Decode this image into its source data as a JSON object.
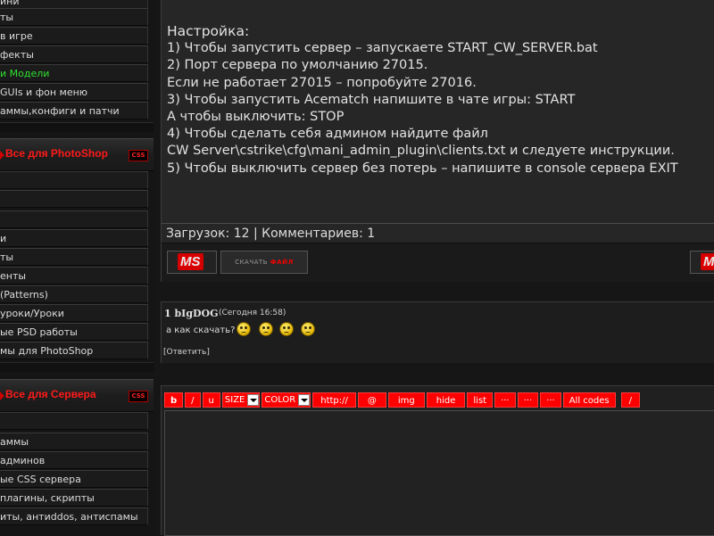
{
  "sidebar": {
    "top_items": [
      {
        "label": "ини"
      },
      {
        "label": "ты"
      },
      {
        "label": "в игре"
      },
      {
        "label": "фекты"
      },
      {
        "label": "и Модели",
        "highlight": true
      },
      {
        "label": "GUIs и фон меню"
      },
      {
        "label": "аммы,конфиги и патчи"
      }
    ],
    "photoshop_block": {
      "title": "Все для PhotoShop",
      "badge": "CSS",
      "items": [
        {
          "label": ""
        },
        {
          "label": ""
        },
        {
          "label": ""
        },
        {
          "label": "и"
        },
        {
          "label": "ты"
        },
        {
          "label": "енты"
        },
        {
          "label": "(Patterns)"
        },
        {
          "label": "уроки/Уроки"
        },
        {
          "label": "ые PSD работы"
        },
        {
          "label": "мы для PhotoShop"
        }
      ]
    },
    "server_block": {
      "title": "Все для Сервера",
      "badge": "CSS",
      "items": [
        {
          "label": ""
        },
        {
          "label": "аммы"
        },
        {
          "label": "админов"
        },
        {
          "label": "ые CSS сервера"
        },
        {
          "label": "плагины, скрипты"
        },
        {
          "label": "иты, антиddos, антиспамы"
        }
      ]
    }
  },
  "article": {
    "heading": "Настройка:",
    "lines": [
      "1) Чтобы запустить сервер – запускаете START_CW_SERVER.bat",
      "2) Порт сервера по умолчанию 27015.",
      "Если не работает 27015 – попробуйте 27016.",
      "3) Чтобы запустить Acematch напишите в чате игры: START",
      "А чтобы выключить: STOP",
      "4) Чтобы сделать себя админом найдите файл",
      "CW Server\\cstrike\\cfg\\mani_admin_plugin\\clients.txt и следуете инструкции.",
      "5) Чтобы выключить сервер без потерь – напишите в console сервера EXIT"
    ]
  },
  "stats": {
    "text": "Загрузок: 12 | Комментариев: 1"
  },
  "buttons": {
    "ms_label": "MS",
    "download_prefix": "СКАЧАТЬ",
    "download_word": "ФАЙЛ"
  },
  "comment": {
    "author": "1 bIgDOG",
    "date": "(Сегодня 16:58)",
    "text": "а как скачать?",
    "smileys": [
      "angry-smiley-icon",
      "angry-smiley-icon",
      "angry-smiley-icon",
      "angry-smiley-icon"
    ],
    "reply": "[Ответить]"
  },
  "editor": {
    "toolbar": {
      "bold": "b",
      "italic": "/",
      "underline": "u",
      "size": "SIZE",
      "color": "COLOR",
      "http": "http://",
      "at": "@",
      "img": "img",
      "hide": "hide",
      "list": "list",
      "dots1": "···",
      "dots2": "···",
      "dots3": "···",
      "all_codes": "All codes",
      "slash": "/"
    }
  },
  "colors": {
    "accent_red": "#ff0000",
    "header_red": "#ff1a1a",
    "highlight_green": "#2fe02f",
    "panel_bg": "#262626"
  }
}
